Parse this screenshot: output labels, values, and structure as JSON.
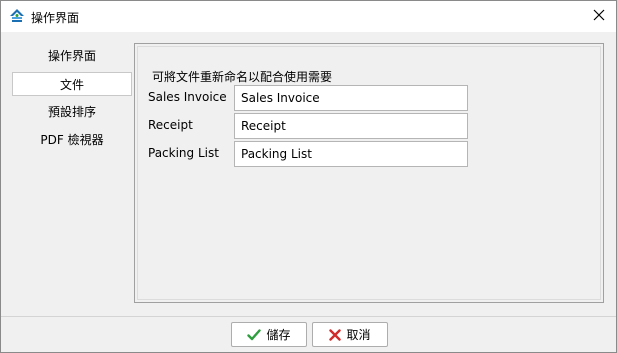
{
  "window": {
    "title": "操作界面"
  },
  "nav": {
    "items": [
      {
        "label": "操作界面"
      },
      {
        "label": "文件"
      },
      {
        "label": "預設排序"
      },
      {
        "label": "PDF 檢視器"
      }
    ]
  },
  "panel": {
    "heading": "可將文件重新命名以配合使用需要",
    "fields": [
      {
        "label": "Sales Invoice",
        "value": "Sales Invoice"
      },
      {
        "label": "Receipt",
        "value": "Receipt"
      },
      {
        "label": "Packing List",
        "value": "Packing List"
      }
    ]
  },
  "footer": {
    "save_label": "儲存",
    "cancel_label": "取消"
  },
  "icons": {
    "app": "app-logo-icon",
    "close": "close-icon",
    "save": "checkmark-icon",
    "cancel": "x-icon"
  },
  "colors": {
    "check": "#2e9e3e",
    "cancel_x": "#d12a2a",
    "logo": "#1b6fb3"
  }
}
